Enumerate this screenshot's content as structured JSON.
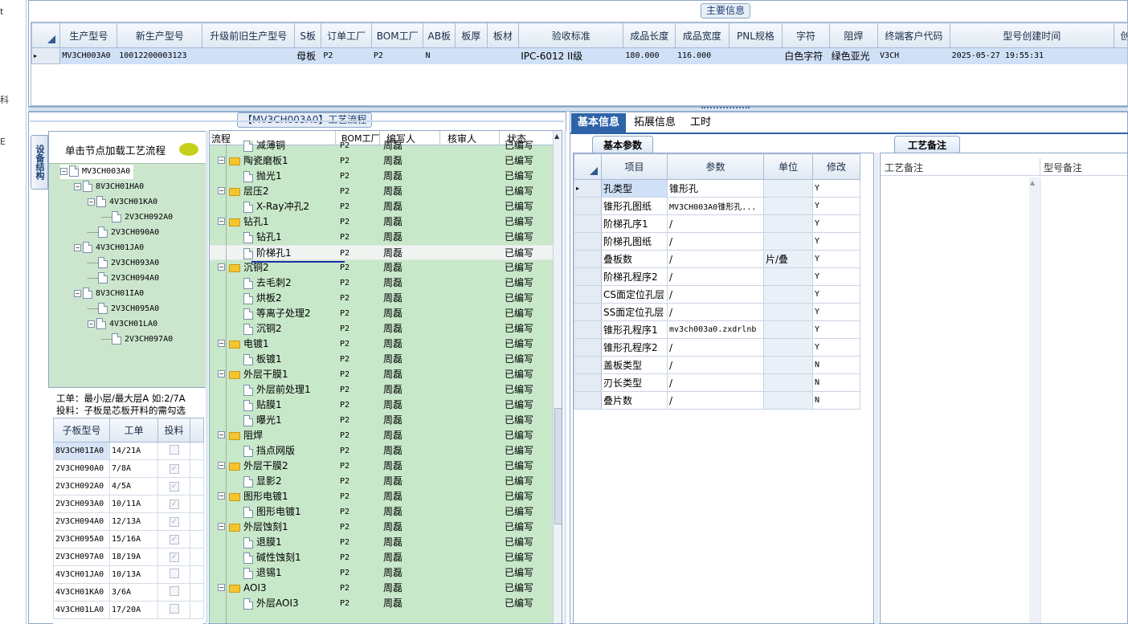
{
  "main_info": {
    "title": "主要信息",
    "columns": [
      "生产型号",
      "新生产型号",
      "升级前旧生产型号",
      "S板",
      "订单工厂",
      "BOM工厂",
      "AB板",
      "板厚",
      "板材",
      "验收标准",
      "成品长度",
      "成品宽度",
      "PNL规格",
      "字符",
      "阻焊",
      "终端客户代码",
      "型号创建时间",
      "创建人"
    ],
    "row": [
      "MV3CH003A0",
      "10012200003123",
      "",
      "母板",
      "P2",
      "P2",
      "N",
      "",
      "",
      "IPC-6012 II级",
      "180.000",
      "116.000",
      "",
      "白色字符",
      "绿色亚光",
      "V3CH",
      "2025-05-27 19:55:31",
      ""
    ]
  },
  "process": {
    "title": "【MV3CH003A0】工艺流程",
    "vtab_label": "设备结构",
    "click_hint": "单击节点加载工艺流程",
    "tree": [
      {
        "label": "MV3CH003A0",
        "level": 0
      },
      {
        "label": "8V3CH01HA0",
        "level": 1
      },
      {
        "label": "4V3CH01KA0",
        "level": 2
      },
      {
        "label": "2V3CH092A0",
        "level": 3
      },
      {
        "label": "2V3CH090A0",
        "level": 2
      },
      {
        "label": "4V3CH01JA0",
        "level": 1
      },
      {
        "label": "2V3CH093A0",
        "level": 2
      },
      {
        "label": "2V3CH094A0",
        "level": 2
      },
      {
        "label": "8V3CH01IA0",
        "level": 1
      },
      {
        "label": "2V3CH095A0",
        "level": 2
      },
      {
        "label": "4V3CH01LA0",
        "level": 2
      },
      {
        "label": "2V3CH097A0",
        "level": 3
      }
    ],
    "hint_line1": "工单：最小层/最大层A 如:2/7A",
    "hint_line2": "投料：子板是芯板开料的需勾选",
    "sub_columns": [
      "子板型号",
      "工单",
      "投料"
    ],
    "sub_rows": [
      {
        "model": "8V3CH01IA0",
        "order": "14/21A",
        "checked": false
      },
      {
        "model": "2V3CH090A0",
        "order": "7/8A",
        "checked": true
      },
      {
        "model": "2V3CH092A0",
        "order": "4/5A",
        "checked": true
      },
      {
        "model": "2V3CH093A0",
        "order": "10/11A",
        "checked": true
      },
      {
        "model": "2V3CH094A0",
        "order": "12/13A",
        "checked": true
      },
      {
        "model": "2V3CH095A0",
        "order": "15/16A",
        "checked": true
      },
      {
        "model": "2V3CH097A0",
        "order": "18/19A",
        "checked": true
      },
      {
        "model": "4V3CH01JA0",
        "order": "10/13A",
        "checked": false
      },
      {
        "model": "4V3CH01KA0",
        "order": "3/6A",
        "checked": false
      },
      {
        "model": "4V3CH01LA0",
        "order": "17/20A",
        "checked": false
      }
    ],
    "flow_columns": [
      "流程",
      "BOM工厂",
      "编写人",
      "核审人",
      "状态"
    ],
    "flow_rows": [
      {
        "name": "减薄铜",
        "type": "doc",
        "factory": "P2",
        "writer": "周磊",
        "status": "已编写"
      },
      {
        "name": "陶瓷磨板1",
        "type": "folder",
        "factory": "P2",
        "writer": "周磊",
        "status": "已编写"
      },
      {
        "name": "抛光1",
        "type": "doc",
        "factory": "P2",
        "writer": "周磊",
        "status": "已编写"
      },
      {
        "name": "层压2",
        "type": "folder",
        "factory": "P2",
        "writer": "周磊",
        "status": "已编写"
      },
      {
        "name": "X-Ray冲孔2",
        "type": "doc",
        "factory": "P2",
        "writer": "周磊",
        "status": "已编写"
      },
      {
        "name": "钻孔1",
        "type": "folder",
        "factory": "P2",
        "writer": "周磊",
        "status": "已编写"
      },
      {
        "name": "钻孔1",
        "type": "doc",
        "factory": "P2",
        "writer": "周磊",
        "status": "已编写"
      },
      {
        "name": "阶梯孔1",
        "type": "doc",
        "factory": "P2",
        "writer": "周磊",
        "status": "已编写",
        "selected": true
      },
      {
        "name": "沉铜2",
        "type": "folder",
        "factory": "P2",
        "writer": "周磊",
        "status": "已编写"
      },
      {
        "name": "去毛刺2",
        "type": "doc",
        "factory": "P2",
        "writer": "周磊",
        "status": "已编写"
      },
      {
        "name": "烘板2",
        "type": "doc",
        "factory": "P2",
        "writer": "周磊",
        "status": "已编写"
      },
      {
        "name": "等离子处理2",
        "type": "doc",
        "factory": "P2",
        "writer": "周磊",
        "status": "已编写"
      },
      {
        "name": "沉铜2",
        "type": "doc",
        "factory": "P2",
        "writer": "周磊",
        "status": "已编写"
      },
      {
        "name": "电镀1",
        "type": "folder",
        "factory": "P2",
        "writer": "周磊",
        "status": "已编写"
      },
      {
        "name": "板镀1",
        "type": "doc",
        "factory": "P2",
        "writer": "周磊",
        "status": "已编写"
      },
      {
        "name": "外层干膜1",
        "type": "folder",
        "factory": "P2",
        "writer": "周磊",
        "status": "已编写"
      },
      {
        "name": "外层前处理1",
        "type": "doc",
        "factory": "P2",
        "writer": "周磊",
        "status": "已编写"
      },
      {
        "name": "贴膜1",
        "type": "doc",
        "factory": "P2",
        "writer": "周磊",
        "status": "已编写"
      },
      {
        "name": "曝光1",
        "type": "doc",
        "factory": "P2",
        "writer": "周磊",
        "status": "已编写"
      },
      {
        "name": "阻焊",
        "type": "folder",
        "factory": "P2",
        "writer": "周磊",
        "status": "已编写"
      },
      {
        "name": "挡点网版",
        "type": "doc",
        "factory": "P2",
        "writer": "周磊",
        "status": "已编写"
      },
      {
        "name": "外层干膜2",
        "type": "folder",
        "factory": "P2",
        "writer": "周磊",
        "status": "已编写"
      },
      {
        "name": "显影2",
        "type": "doc",
        "factory": "P2",
        "writer": "周磊",
        "status": "已编写"
      },
      {
        "name": "图形电镀1",
        "type": "folder",
        "factory": "P2",
        "writer": "周磊",
        "status": "已编写"
      },
      {
        "name": "图形电镀1",
        "type": "doc",
        "factory": "P2",
        "writer": "周磊",
        "status": "已编写"
      },
      {
        "name": "外层蚀刻1",
        "type": "folder",
        "factory": "P2",
        "writer": "周磊",
        "status": "已编写"
      },
      {
        "name": "退膜1",
        "type": "doc",
        "factory": "P2",
        "writer": "周磊",
        "status": "已编写"
      },
      {
        "name": "碱性蚀刻1",
        "type": "doc",
        "factory": "P2",
        "writer": "周磊",
        "status": "已编写"
      },
      {
        "name": "退锡1",
        "type": "doc",
        "factory": "P2",
        "writer": "周磊",
        "status": "已编写"
      },
      {
        "name": "AOI3",
        "type": "folder",
        "factory": "P2",
        "writer": "周磊",
        "status": "已编写"
      },
      {
        "name": "外层AOI3",
        "type": "doc",
        "factory": "P2",
        "writer": "周磊",
        "status": "已编写"
      }
    ]
  },
  "right": {
    "tabs": [
      "基本信息",
      "拓展信息",
      "工时"
    ],
    "basic_tab": "基本参数",
    "param_columns": [
      "项目",
      "参数",
      "单位",
      "修改"
    ],
    "params": [
      {
        "item": "孔类型",
        "value": "锥形孔",
        "unit": "",
        "mod": "Y"
      },
      {
        "item": "锥形孔图纸",
        "value": "MV3CH003A0锥形孔...",
        "unit": "",
        "mod": "Y"
      },
      {
        "item": "阶梯孔序1",
        "value": "/",
        "unit": "",
        "mod": "Y"
      },
      {
        "item": "阶梯孔图纸",
        "value": "/",
        "unit": "",
        "mod": "Y"
      },
      {
        "item": "叠板数",
        "value": "/",
        "unit": "片/叠",
        "mod": "Y"
      },
      {
        "item": "阶梯孔程序2",
        "value": "/",
        "unit": "",
        "mod": "Y"
      },
      {
        "item": "CS面定位孔层",
        "value": "/",
        "unit": "",
        "mod": "Y"
      },
      {
        "item": "SS面定位孔层",
        "value": "/",
        "unit": "",
        "mod": "Y"
      },
      {
        "item": "锥形孔程序1",
        "value": "mv3ch003a0.zxdrlnb",
        "unit": "",
        "mod": "Y"
      },
      {
        "item": "锥形孔程序2",
        "value": "/",
        "unit": "",
        "mod": "Y"
      },
      {
        "item": "盖板类型",
        "value": "/",
        "unit": "",
        "mod": "N"
      },
      {
        "item": "刃长类型",
        "value": "/",
        "unit": "",
        "mod": "N"
      },
      {
        "item": "叠片数",
        "value": "/",
        "unit": "",
        "mod": "N"
      }
    ],
    "memo_tab": "工艺备注",
    "memo_columns": [
      "工艺备注",
      "型号备注"
    ]
  },
  "left_strip": [
    "t",
    "科",
    "E"
  ]
}
